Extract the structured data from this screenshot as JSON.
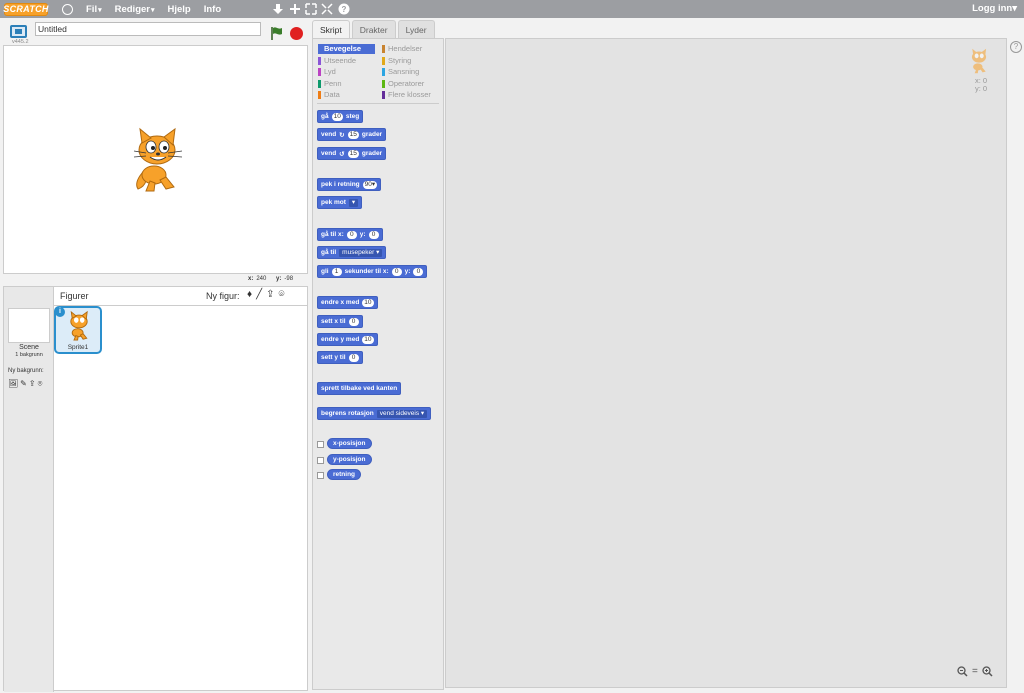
{
  "topbar": {
    "logo_text": "SCRATCH",
    "menus": [
      {
        "label": "Fil",
        "caret": "▾"
      },
      {
        "label": "Rediger",
        "caret": "▾"
      },
      {
        "label": "Hjelp",
        "caret": ""
      },
      {
        "label": "Info",
        "caret": ""
      }
    ],
    "login": "Logg inn",
    "login_caret": "▾",
    "icons": [
      "duplicate-icon",
      "delete-icon",
      "grow-icon",
      "shrink-icon",
      "help-icon"
    ]
  },
  "stage": {
    "version": "v445.2",
    "project_title": "Untitled",
    "coords": {
      "x_label": "x:",
      "x_value": "240",
      "y_label": "y:",
      "y_value": "-98"
    }
  },
  "sprites": {
    "figurer_title": "Figurer",
    "new_sprite_label": "Ny figur:",
    "scene_label": "Scene",
    "scene_sub": "1 bakgrunn",
    "new_bg_label": "Ny bakgrunn:",
    "sprite_name": "Sprite1",
    "info_glyph": "i"
  },
  "tabs": [
    "Skript",
    "Drakter",
    "Lyder"
  ],
  "categories": {
    "left": [
      {
        "label": "Bevegelse",
        "color": "#4a6cd4"
      },
      {
        "label": "Utseende",
        "color": "#8a55d7"
      },
      {
        "label": "Lyd",
        "color": "#bb42c3"
      },
      {
        "label": "Penn",
        "color": "#0e9a6c"
      },
      {
        "label": "Data",
        "color": "#ee7d16"
      }
    ],
    "right": [
      {
        "label": "Hendelser",
        "color": "#c88330"
      },
      {
        "label": "Styring",
        "color": "#e1a91a"
      },
      {
        "label": "Sansning",
        "color": "#2ca5e2"
      },
      {
        "label": "Operatorer",
        "color": "#5cb712"
      },
      {
        "label": "Flere klosser",
        "color": "#632d99"
      }
    ]
  },
  "blocks": {
    "b1": {
      "t1": "gå",
      "v1": "10",
      "t2": "steg"
    },
    "b2": {
      "t1": "vend",
      "icon": "↻",
      "v1": "15",
      "t2": "grader"
    },
    "b3": {
      "t1": "vend",
      "icon": "↺",
      "v1": "15",
      "t2": "grader"
    },
    "b4": {
      "t1": "pek i retning",
      "v1": "90▾"
    },
    "b5": {
      "t1": "pek mot",
      "d1": "▾"
    },
    "b6": {
      "t1": "gå til x:",
      "v1": "0",
      "t2": "y:",
      "v2": "0"
    },
    "b7": {
      "t1": "gå til",
      "d1": "musepeker ▾"
    },
    "b8": {
      "t1": "gli",
      "v1": "1",
      "t2": "sekunder til x:",
      "v2": "0",
      "t3": "y:",
      "v3": "0"
    },
    "b9": {
      "t1": "endre x med",
      "v1": "10"
    },
    "b10": {
      "t1": "sett x til",
      "v1": "0"
    },
    "b11": {
      "t1": "endre y med",
      "v1": "10"
    },
    "b12": {
      "t1": "sett y til",
      "v1": "0"
    },
    "b13": {
      "t1": "sprett tilbake ved kanten"
    },
    "b14": {
      "t1": "begrens rotasjon",
      "d1": "vend sideveis ▾"
    },
    "r1": "x-posisjon",
    "r2": "y-posisjon",
    "r3": "retning"
  },
  "scripts_area": {
    "x_readout": "x: 0",
    "y_readout": "y: 0",
    "zoom_out": "−",
    "zoom_reset": "=",
    "zoom_in": "+"
  },
  "colors": {
    "motion": "#4a6cd4",
    "accent": "#2a8fcd",
    "stop": "#e02020",
    "flag": "#3a7d2a"
  }
}
